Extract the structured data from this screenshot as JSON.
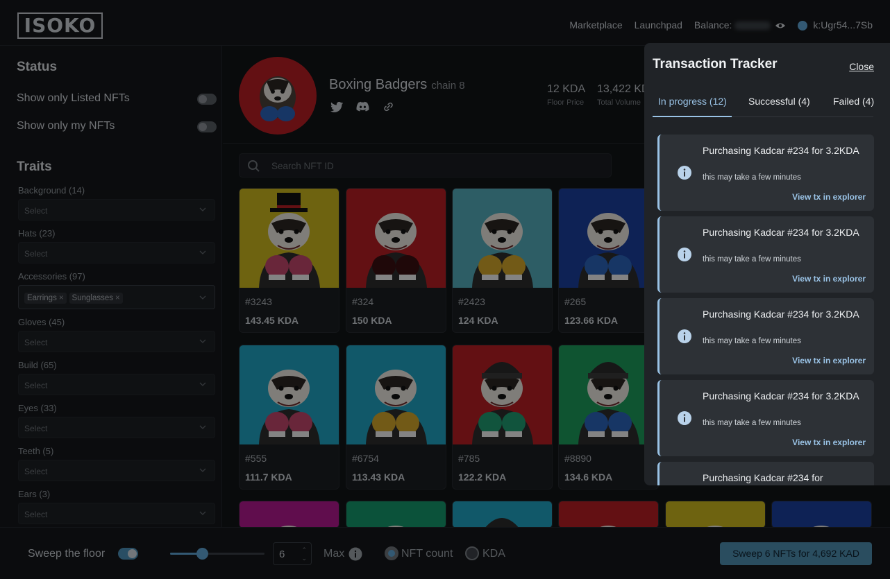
{
  "header": {
    "logo": "ISOKO",
    "nav": [
      "Marketplace",
      "Launchpad"
    ],
    "balance_label": "Balance:",
    "wallet": "k:Ugr54...7Sb"
  },
  "sidebar": {
    "status_title": "Status",
    "toggles": [
      "Show only Listed NFTs",
      "Show only my NFTs"
    ],
    "traits_title": "Traits",
    "traits": [
      {
        "label": "Background (14)",
        "value": "Select"
      },
      {
        "label": "Hats (23)",
        "value": "Select"
      },
      {
        "label": "Accessories (97)",
        "tags": [
          "Earrings",
          "Sunglasses"
        ]
      },
      {
        "label": "Gloves (45)",
        "value": "Select"
      },
      {
        "label": "Build (65)",
        "value": "Select"
      },
      {
        "label": "Eyes (33)",
        "value": "Select"
      },
      {
        "label": "Teeth (5)",
        "value": "Select"
      },
      {
        "label": "Ears (3)",
        "value": "Select"
      }
    ]
  },
  "collection": {
    "name": "Boxing Badgers",
    "chain": "chain 8",
    "stats": [
      {
        "value": "12 KDA",
        "label": "Floor Price"
      },
      {
        "value": "13,422 KDA",
        "label": "Total Volume"
      }
    ],
    "search_placeholder": "Search NFT ID"
  },
  "nfts": [
    {
      "id": "#3243",
      "price": "143.45 KDA",
      "bg": "#c9b51e",
      "glove": "#c0456b",
      "hat": "tophat"
    },
    {
      "id": "#324",
      "price": "150 KDA",
      "bg": "#b41e24",
      "glove": "#3a0f12",
      "hat": "none"
    },
    {
      "id": "#2423",
      "price": "124 KDA",
      "bg": "#52a9b8",
      "glove": "#cfa42a",
      "hat": "none"
    },
    {
      "id": "#265",
      "price": "123.66 KDA",
      "bg": "#1b3f9c",
      "glove": "#2a63b8",
      "hat": "none"
    },
    {
      "id": "#555",
      "price": "111.7 KDA",
      "bg": "#1fa1c0",
      "glove": "#c0456b",
      "hat": "none"
    },
    {
      "id": "#6754",
      "price": "113.43 KDA",
      "bg": "#1fa1c0",
      "glove": "#cfa42a",
      "hat": "none"
    },
    {
      "id": "#785",
      "price": "122.2 KDA",
      "bg": "#b41e24",
      "glove": "#1f9a70",
      "hat": "beanie"
    },
    {
      "id": "#8890",
      "price": "134.6 KDA",
      "bg": "#1c9a5a",
      "glove": "#2a63b8",
      "hat": "beanie"
    }
  ],
  "nfts_row3": [
    {
      "bg": "#b0188c"
    },
    {
      "bg": "#15966a"
    },
    {
      "bg": "#1fa1c0"
    },
    {
      "bg": "#b41e24"
    },
    {
      "bg": "#c9b51e"
    },
    {
      "bg": "#1b3f9c"
    }
  ],
  "footer": {
    "sweep_label": "Sweep the floor",
    "count": "6",
    "max_label": "Max",
    "radio_nft": "NFT count",
    "radio_kda": "KDA",
    "sweep_button": "Sweep 6 NFTs for 4,692 KAD",
    "slider_fraction": 0.35
  },
  "tracker": {
    "title": "Transaction Tracker",
    "close": "Close",
    "tabs": [
      "In progress (12)",
      "Successful (4)",
      "Failed (4)"
    ],
    "items": [
      {
        "title": "Purchasing Kadcar #234 for 3.2KDA",
        "sub": "this may take a few minutes",
        "link": "View tx in explorer"
      },
      {
        "title": "Purchasing Kadcar #234 for 3.2KDA",
        "sub": "this may take a few minutes",
        "link": "View tx in explorer"
      },
      {
        "title": "Purchasing Kadcar #234 for 3.2KDA",
        "sub": "this may take a few minutes",
        "link": "View tx in explorer"
      },
      {
        "title": "Purchasing Kadcar #234 for 3.2KDA",
        "sub": "this may take a few minutes",
        "link": "View tx in explorer"
      },
      {
        "title": "Purchasing Kadcar #234 for",
        "sub": "",
        "link": ""
      }
    ]
  },
  "colors": {
    "accent": "#9ac3e6",
    "primary": "#4d8cad"
  }
}
